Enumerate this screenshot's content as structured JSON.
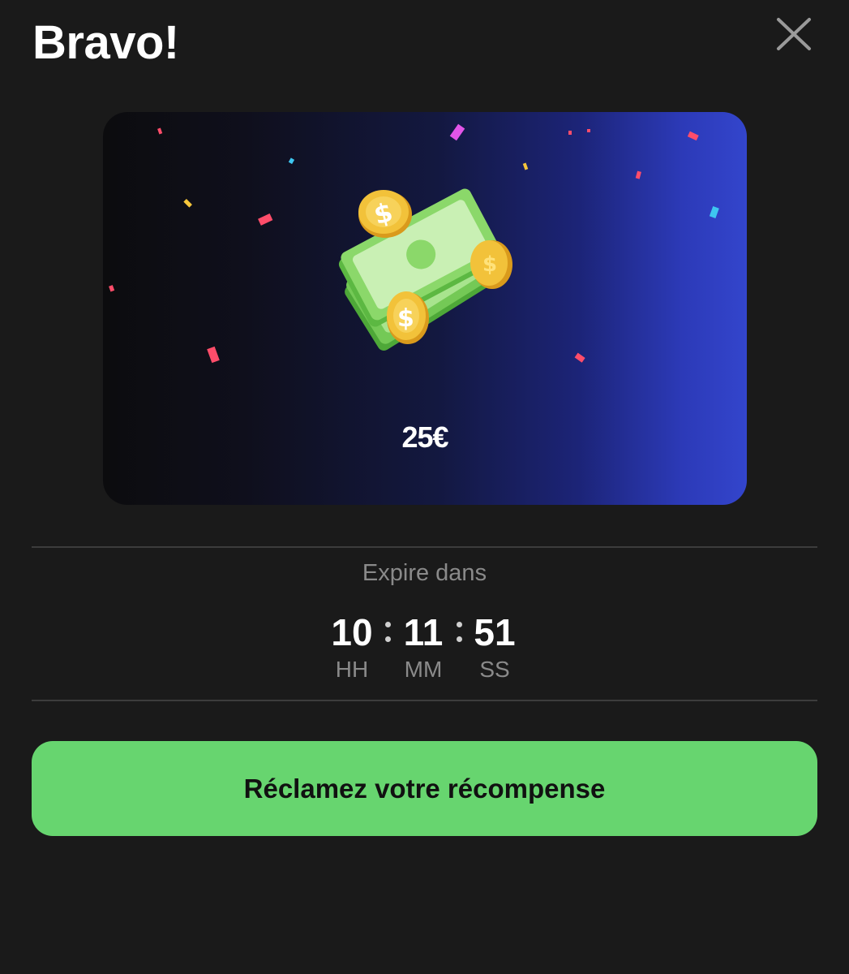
{
  "header": {
    "title": "Bravo!",
    "close_icon": "close-icon"
  },
  "reward": {
    "amount": "25€",
    "illustration_icon": "cash-and-coins-icon",
    "colors": {
      "card_gradient_start": "#0c0c0e",
      "card_gradient_end": "#3345cc"
    }
  },
  "expiry": {
    "label": "Expire dans",
    "hours": "10",
    "minutes": "11",
    "seconds": "51",
    "hours_label": "HH",
    "minutes_label": "MM",
    "seconds_label": "SS"
  },
  "cta": {
    "label": "Réclamez votre récompense",
    "color": "#67d56f"
  }
}
